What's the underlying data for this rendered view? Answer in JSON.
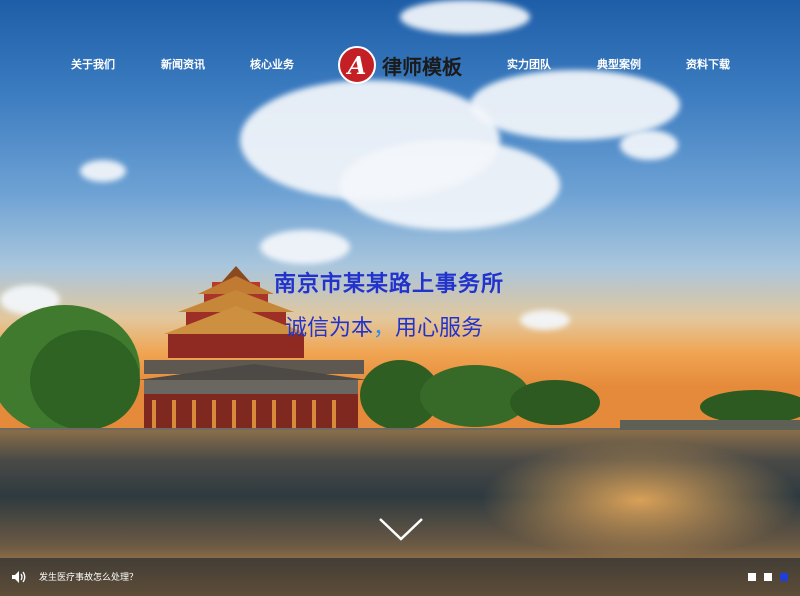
{
  "nav": {
    "items": [
      {
        "label": "关于我们"
      },
      {
        "label": "新闻资讯"
      },
      {
        "label": "核心业务"
      },
      {
        "label": "实力团队"
      },
      {
        "label": "典型案例"
      },
      {
        "label": "资料下载"
      }
    ],
    "logo": {
      "mark": "A",
      "text": "律师模板"
    }
  },
  "hero": {
    "title": "南京市某某路上事务所",
    "subtitle_left": "诚信为本",
    "subtitle_sep": "，",
    "subtitle_right": "用心服务"
  },
  "bottom_bar": {
    "news_text": "发生医疗事故怎么处理？",
    "slides": [
      {
        "active": false
      },
      {
        "active": false
      },
      {
        "active": true
      }
    ]
  },
  "colors": {
    "logo_red": "#c41f25",
    "hero_text": "#2233cc",
    "dot_active": "#1f3fd8",
    "dot_inactive": "#ffffff"
  },
  "icons": [
    "speaker-icon",
    "chevron-down-icon"
  ]
}
